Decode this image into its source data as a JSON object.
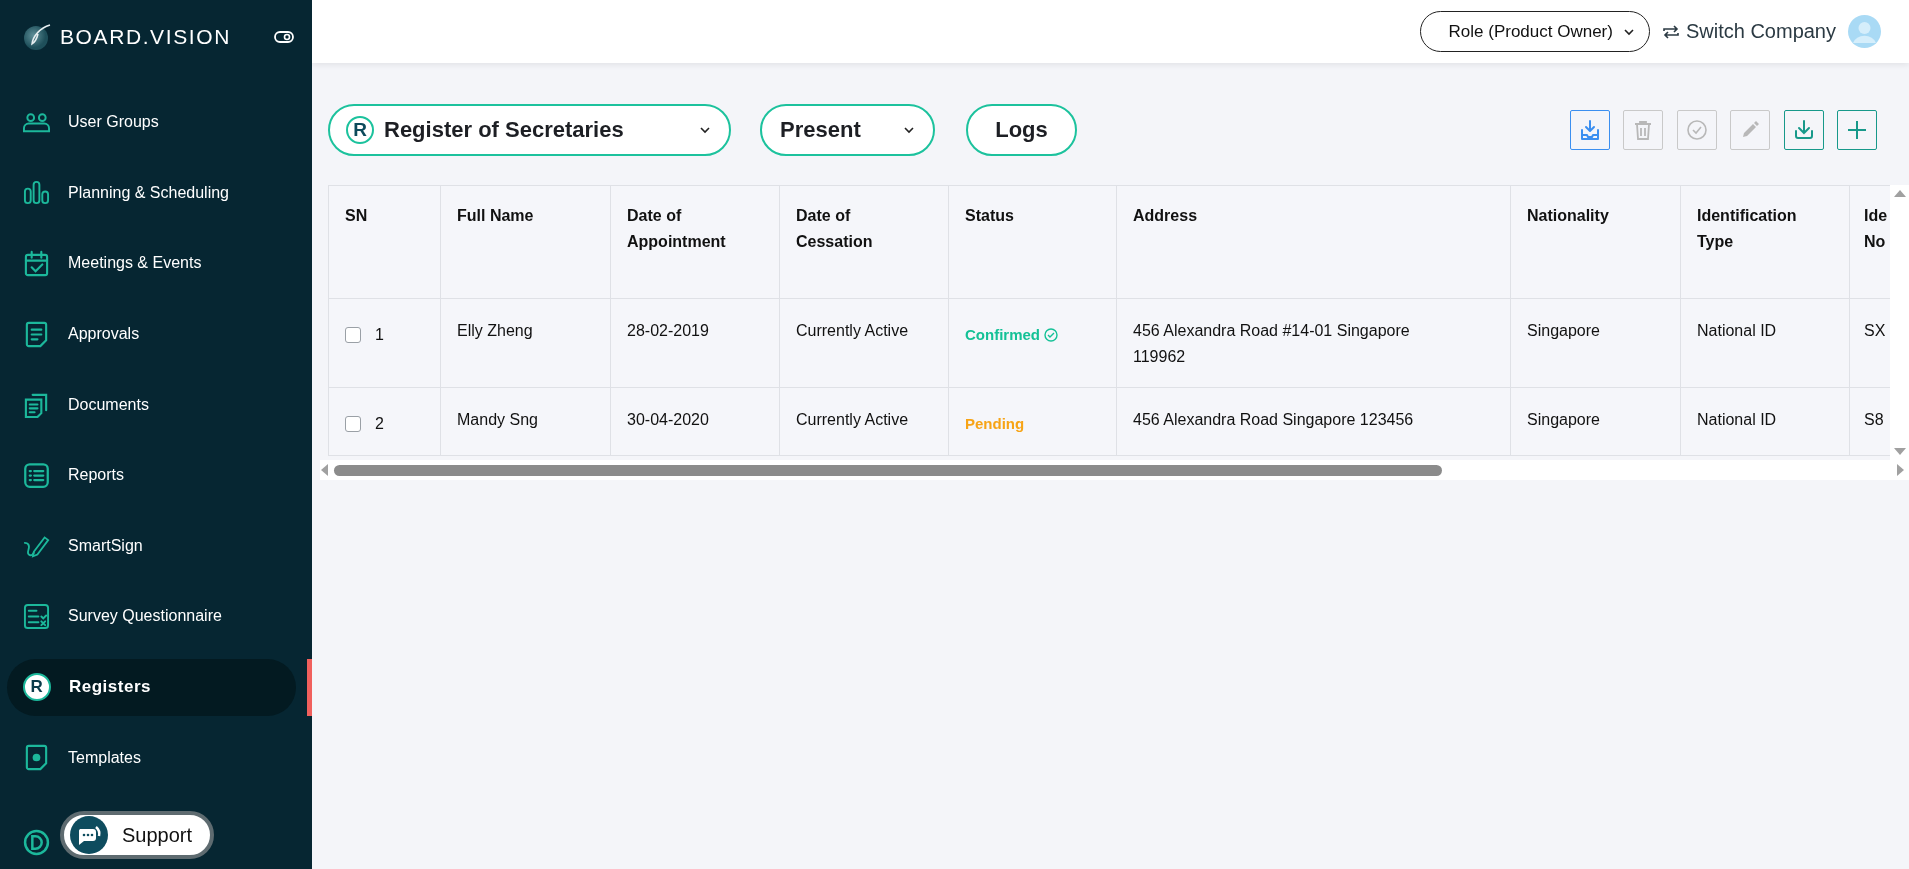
{
  "sidebar": {
    "logo": "BOARD.VISION",
    "items": [
      {
        "label": "User Groups",
        "kind": "users",
        "selected": false
      },
      {
        "label": "Planning & Scheduling",
        "kind": "bars",
        "selected": false
      },
      {
        "label": "Meetings & Events",
        "kind": "calendar",
        "selected": false
      },
      {
        "label": "Approvals",
        "kind": "doc",
        "selected": false
      },
      {
        "label": "Documents",
        "kind": "docs",
        "selected": false
      },
      {
        "label": "Reports",
        "kind": "list",
        "selected": false
      },
      {
        "label": "SmartSign",
        "kind": "pen",
        "selected": false
      },
      {
        "label": "Survey Questionnaire",
        "kind": "survey",
        "selected": false
      },
      {
        "label": "Registers",
        "kind": "letter",
        "badge": "R",
        "selected": true
      },
      {
        "label": "Templates",
        "kind": "template",
        "selected": false
      },
      {
        "kind": "d-circle"
      }
    ]
  },
  "support_button": {
    "label": "Support"
  },
  "header": {
    "role": "Role (Product Owner)",
    "switch_company": "Switch Company"
  },
  "toolbar": {
    "register_badge": "R",
    "register": "Register of Secretaries",
    "filter": "Present",
    "logs": "Logs",
    "actions": [
      {
        "kind": "import",
        "disabled": false
      },
      {
        "kind": "delete",
        "disabled": true
      },
      {
        "kind": "approve",
        "disabled": true
      },
      {
        "kind": "edit",
        "disabled": true
      },
      {
        "kind": "download",
        "disabled": false
      },
      {
        "kind": "add",
        "disabled": false
      }
    ]
  },
  "table": {
    "columns": [
      "SN",
      "Full Name",
      "Date of Appointment",
      "Date of Cessation",
      "Status",
      "Address",
      "Nationality",
      "Identification Type",
      "Ide No"
    ],
    "rows": [
      {
        "checked": false,
        "cells": [
          "1",
          "Elly Zheng",
          "28-02-2019",
          "Currently Active",
          {
            "text": "Confirmed",
            "kind": "confirmed"
          },
          "456 Alexandra Road #14-01 Singapore 119962",
          "Singapore",
          "National ID",
          "SX"
        ]
      },
      {
        "checked": false,
        "cells": [
          "2",
          "Mandy Sng",
          "30-04-2020",
          "Currently Active",
          {
            "text": "Pending",
            "kind": "pending"
          },
          "456 Alexandra Road Singapore 123456",
          "Singapore",
          "National ID",
          "S8"
        ]
      }
    ]
  }
}
